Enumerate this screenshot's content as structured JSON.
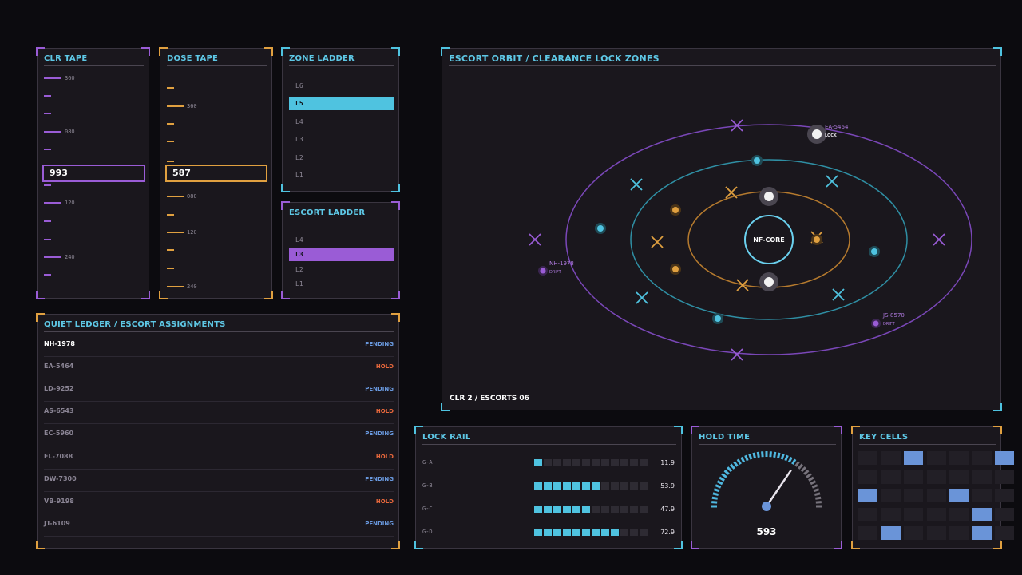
{
  "clr_tape": {
    "title": "CLR TAPE",
    "readout": "993",
    "labels": [
      "360",
      "080",
      "120",
      "240"
    ],
    "accent": "#9a5cd6"
  },
  "dose_tape": {
    "title": "DOSE TAPE",
    "readout": "587",
    "labels": [
      "360",
      "080",
      "120",
      "240"
    ],
    "accent": "#e0a040"
  },
  "zone_ladder": {
    "title": "ZONE LADDER",
    "items": [
      "L6",
      "L5",
      "L4",
      "L3",
      "L2",
      "L1"
    ],
    "selected": "L5",
    "accent": "#4fc3e0"
  },
  "escort_ladder": {
    "title": "ESCORT LADDER",
    "items": [
      "L4",
      "L3",
      "L2",
      "L1"
    ],
    "selected": "L3",
    "accent": "#9a5cd6"
  },
  "ledger": {
    "title": "QUIET LEDGER / ESCORT ASSIGNMENTS",
    "rows": [
      {
        "id": "NH-1978",
        "status": "PENDING"
      },
      {
        "id": "EA-5464",
        "status": "HOLD"
      },
      {
        "id": "LD-9252",
        "status": "PENDING"
      },
      {
        "id": "AS-6543",
        "status": "HOLD"
      },
      {
        "id": "EC-5960",
        "status": "PENDING"
      },
      {
        "id": "FL-7088",
        "status": "HOLD"
      },
      {
        "id": "DW-7300",
        "status": "PENDING"
      },
      {
        "id": "VB-9198",
        "status": "HOLD"
      },
      {
        "id": "JT-6109",
        "status": "PENDING"
      }
    ],
    "pending_color": "#6a9ae0",
    "hold_color": "#e8683c"
  },
  "orbit": {
    "title": "ESCORT ORBIT / CLEARANCE LOCK ZONES",
    "core_label": "NF-CORE",
    "footer": "CLR 2 / ESCORTS 06",
    "tags": [
      {
        "id": "EA-5464",
        "sub": "LOCK"
      },
      {
        "id": "NH-1978",
        "sub": "DRIFT"
      },
      {
        "id": "JS-8570",
        "sub": "DRIFT"
      }
    ]
  },
  "lock_rail": {
    "title": "LOCK RAIL",
    "rows": [
      {
        "label": "G-A",
        "value": "11.9",
        "fill": 1
      },
      {
        "label": "G-B",
        "value": "53.9",
        "fill": 7
      },
      {
        "label": "G-C",
        "value": "47.9",
        "fill": 6
      },
      {
        "label": "G-D",
        "value": "72.9",
        "fill": 9
      }
    ],
    "segments": 12,
    "accent": "#4fc3e0"
  },
  "hold_time": {
    "title": "HOLD TIME",
    "value": "593",
    "fraction": 0.69
  },
  "key_cells": {
    "title": "KEY CELLS",
    "active": [
      [
        0,
        2
      ],
      [
        0,
        6
      ],
      [
        2,
        0
      ],
      [
        2,
        4
      ],
      [
        3,
        5
      ],
      [
        4,
        1
      ],
      [
        4,
        5
      ]
    ],
    "cols": 7,
    "rows": 5,
    "accent": "#6a94d8"
  }
}
